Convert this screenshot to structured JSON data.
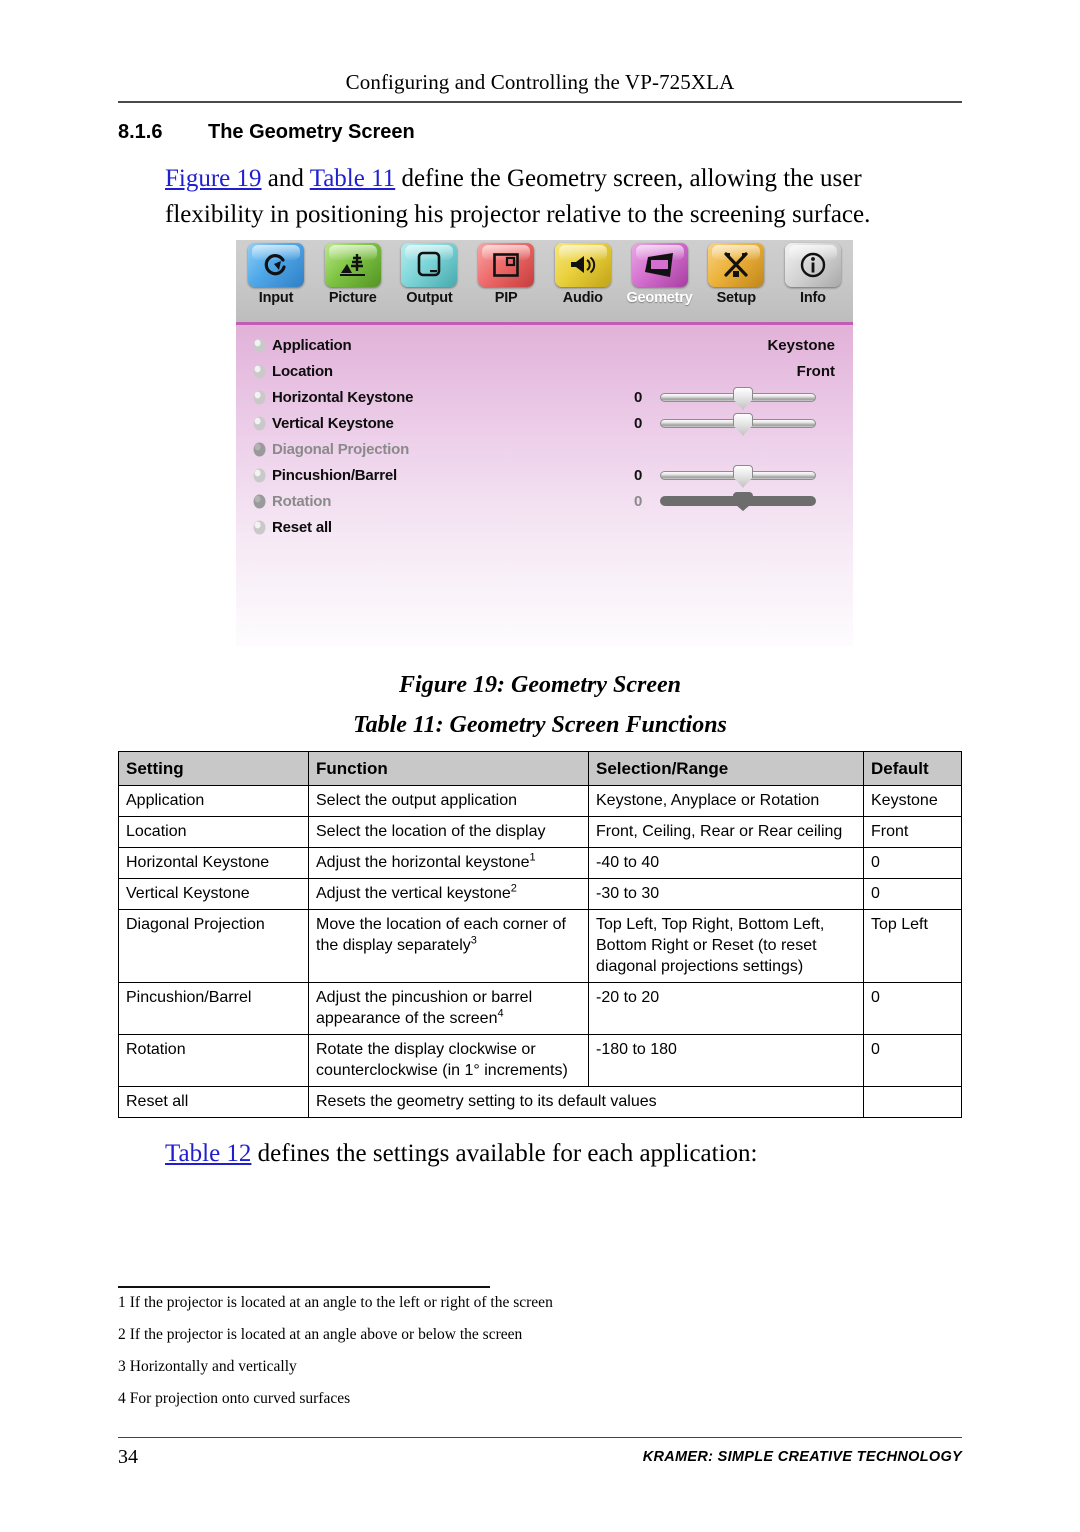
{
  "header": {
    "running_title": "Configuring and Controlling the VP-725XLA"
  },
  "section": {
    "number": "8.1.6",
    "title": "The Geometry Screen",
    "intro_parts": {
      "link1": "Figure 19",
      "mid1": " and ",
      "link2": "Table 11",
      "rest": " define the Geometry screen, allowing the user flexibility in positioning his projector relative to the screening surface."
    }
  },
  "osd": {
    "toolbar": [
      {
        "label": "Input",
        "icon": "rotate-arrow-icon",
        "color": "#4fa7e8",
        "selected": false
      },
      {
        "label": "Picture",
        "icon": "landscape-icon",
        "color": "#7ec443",
        "selected": false
      },
      {
        "label": "Output",
        "icon": "monitor-icon",
        "color": "#7fd6d9",
        "selected": false
      },
      {
        "label": "PIP",
        "icon": "picture-in-picture-icon",
        "color": "#ef6b6b",
        "selected": false
      },
      {
        "label": "Audio",
        "icon": "speaker-icon",
        "color": "#ead03c",
        "selected": false
      },
      {
        "label": "Geometry",
        "icon": "keystone-icon",
        "color": "#d470cf",
        "selected": true
      },
      {
        "label": "Setup",
        "icon": "tools-icon",
        "color": "#edb23a",
        "selected": false
      },
      {
        "label": "Info",
        "icon": "info-icon",
        "color": "#cfcfcf",
        "selected": false
      }
    ],
    "rows": [
      {
        "name": "Application",
        "value": "Keystone",
        "num": null,
        "slider": false,
        "disabled": false
      },
      {
        "name": "Location",
        "value": "Front",
        "num": null,
        "slider": false,
        "disabled": false
      },
      {
        "name": "Horizontal Keystone",
        "value": null,
        "num": "0",
        "slider": true,
        "disabled": false
      },
      {
        "name": "Vertical Keystone",
        "value": null,
        "num": "0",
        "slider": true,
        "disabled": false
      },
      {
        "name": "Diagonal Projection",
        "value": null,
        "num": null,
        "slider": false,
        "disabled": true
      },
      {
        "name": "Pincushion/Barrel",
        "value": null,
        "num": "0",
        "slider": true,
        "disabled": false
      },
      {
        "name": "Rotation",
        "value": null,
        "num": "0",
        "slider": true,
        "disabled": true
      },
      {
        "name": "Reset all",
        "value": null,
        "num": null,
        "slider": false,
        "disabled": false
      }
    ]
  },
  "captions": {
    "figure": "Figure 19: Geometry Screen",
    "table": "Table 11: Geometry Screen Functions"
  },
  "table": {
    "headers": [
      "Setting",
      "Function",
      "Selection/Range",
      "Default"
    ],
    "rows": [
      {
        "setting": "Application",
        "function": "Select the output application",
        "function_sup": "",
        "range": "Keystone, Anyplace or Rotation",
        "default": "Keystone"
      },
      {
        "setting": "Location",
        "function": "Select the location of the display",
        "function_sup": "",
        "range": "Front, Ceiling, Rear or Rear ceiling",
        "default": "Front"
      },
      {
        "setting": "Horizontal Keystone",
        "function": "Adjust the horizontal keystone",
        "function_sup": "1",
        "range": "-40 to 40",
        "default": "0"
      },
      {
        "setting": "Vertical Keystone",
        "function": "Adjust the vertical keystone",
        "function_sup": "2",
        "range": "-30 to 30",
        "default": "0"
      },
      {
        "setting": "Diagonal Projection",
        "function": "Move the location of each corner of the display separately",
        "function_sup": "3",
        "range": "Top Left, Top Right, Bottom Left, Bottom Right or Reset (to reset diagonal projections settings)",
        "default": "Top Left"
      },
      {
        "setting": "Pincushion/Barrel",
        "function": "Adjust the pincushion or barrel appearance of the screen",
        "function_sup": "4",
        "range": "-20 to 20",
        "default": "0"
      },
      {
        "setting": "Rotation",
        "function": "Rotate the display clockwise or counterclockwise (in 1° increments)",
        "function_sup": "",
        "range": "-180 to 180",
        "default": "0"
      },
      {
        "setting": "Reset all",
        "function": "Resets the geometry setting to its default values",
        "function_sup": "",
        "range": "",
        "default": ""
      }
    ]
  },
  "closing": {
    "link": "Table 12",
    "rest": " defines the settings available for each application:"
  },
  "footnotes": [
    {
      "num": "1",
      "text": "If the projector is located at an angle to the left or right of the screen"
    },
    {
      "num": "2",
      "text": "If the projector is located at an angle above or below the screen"
    },
    {
      "num": "3",
      "text": "Horizontally and vertically"
    },
    {
      "num": "4",
      "text": "For projection onto curved surfaces"
    }
  ],
  "footer": {
    "page_number": "34",
    "brand": "KRAMER: SIMPLE CREATIVE TECHNOLOGY"
  }
}
